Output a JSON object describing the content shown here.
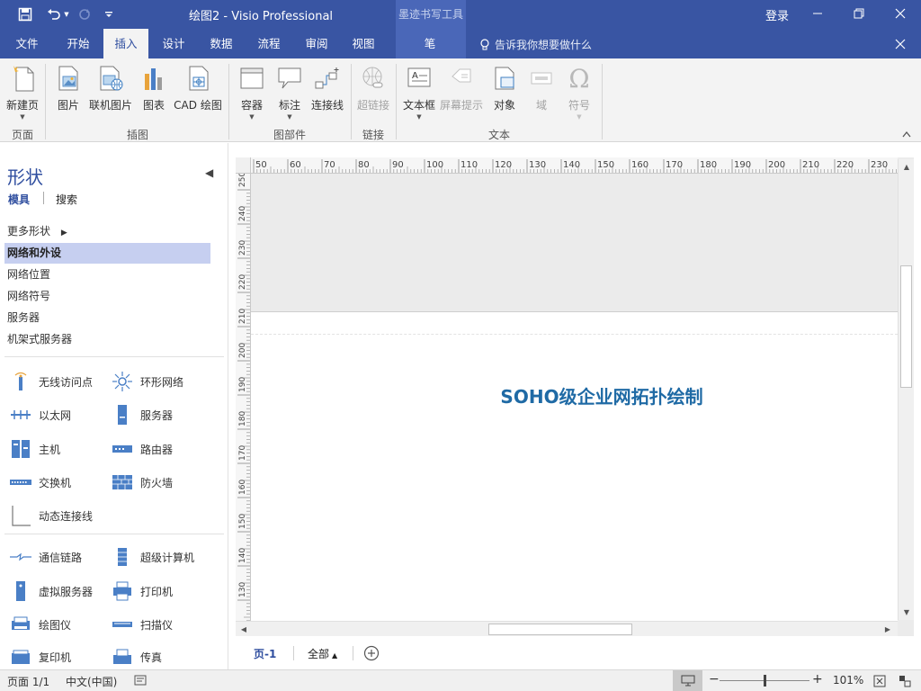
{
  "window": {
    "title": "绘图2 - Visio Professional",
    "context_tool": "墨迹书写工具",
    "login": "登录"
  },
  "tabs": [
    {
      "label": "文件"
    },
    {
      "label": "开始"
    },
    {
      "label": "插入"
    },
    {
      "label": "设计"
    },
    {
      "label": "数据"
    },
    {
      "label": "流程"
    },
    {
      "label": "审阅"
    },
    {
      "label": "视图"
    },
    {
      "label": "笔"
    }
  ],
  "tell_me": "告诉我你想要做什么",
  "ribbon": {
    "buttons": {
      "new_page": "新建页",
      "picture": "图片",
      "online_picture": "联机图片",
      "chart": "图表",
      "cad": "CAD 绘图",
      "container": "容器",
      "callout": "标注",
      "connector": "连接线",
      "hyperlink": "超链接",
      "textbox": "文本框",
      "screentip": "屏幕提示",
      "object": "对象",
      "field": "域",
      "symbol": "符号"
    },
    "groups": {
      "pages": "页面",
      "illustrations": "插图",
      "diagram_parts": "图部件",
      "links": "链接",
      "text": "文本"
    }
  },
  "shapes_pane": {
    "title": "形状",
    "tab_stencils": "模具",
    "tab_search": "搜索",
    "stencils": [
      "更多形状",
      "网络和外设",
      "网络位置",
      "网络符号",
      "服务器",
      "机架式服务器"
    ],
    "shapes_a": [
      "无线访问点",
      "环形网络",
      "以太网",
      "服务器",
      "主机",
      "路由器",
      "交换机",
      "防火墙",
      "动态连接线"
    ],
    "shapes_b": [
      "通信链路",
      "超级计算机",
      "虚拟服务器",
      "打印机",
      "绘图仪",
      "扫描仪",
      "复印机",
      "传真"
    ]
  },
  "ruler": {
    "h_ticks": [
      "50",
      "60",
      "70",
      "80",
      "90",
      "100",
      "110",
      "120",
      "130",
      "140",
      "150",
      "160",
      "170",
      "180",
      "190",
      "200",
      "210",
      "220",
      "230"
    ],
    "v_ticks": [
      "250",
      "240",
      "230",
      "220",
      "210",
      "200",
      "190",
      "180",
      "170",
      "160",
      "150",
      "140",
      "130"
    ]
  },
  "canvas": {
    "title": "SOHO级企业网拓扑绘制"
  },
  "page_tabs": {
    "page": "页-1",
    "all": "全部"
  },
  "status": {
    "page": "页面 1/1",
    "language": "中文(中国)",
    "zoom": "101%"
  },
  "colors": {
    "accent": "#3955a3",
    "title_text": "#1f6aa5"
  }
}
